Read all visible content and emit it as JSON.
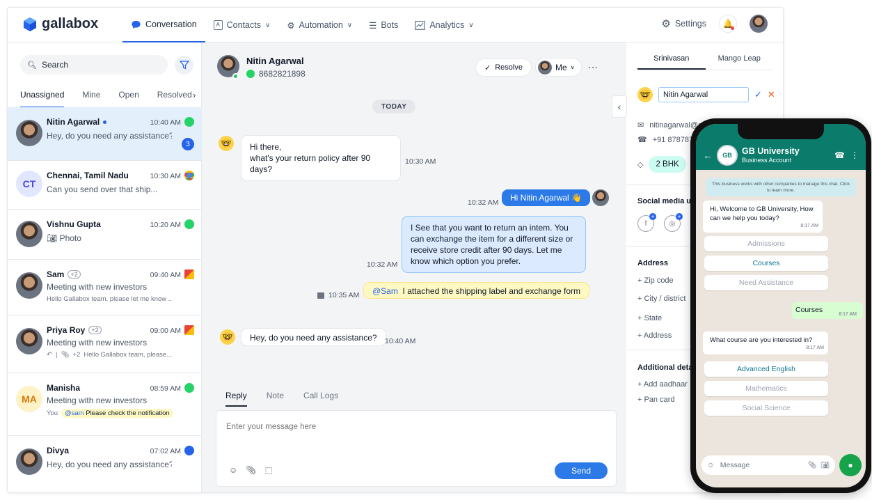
{
  "brand": {
    "name": "gallabox",
    "accent": "#2563eb",
    "whatsapp_green": "#25d366"
  },
  "nav": {
    "items": [
      {
        "label": "Conversation",
        "icon": "chat-bubble-icon",
        "active": true
      },
      {
        "label": "Contacts",
        "icon": "contact-card-icon"
      },
      {
        "label": "Automation",
        "icon": "automation-icon"
      },
      {
        "label": "Bots",
        "icon": "bot-icon"
      },
      {
        "label": "Analytics",
        "icon": "analytics-icon"
      }
    ],
    "settings_label": "Settings"
  },
  "sidebar": {
    "search_label": "Search",
    "tabs": [
      {
        "label": "Unassigned",
        "active": true
      },
      {
        "label": "Mine"
      },
      {
        "label": "Open"
      },
      {
        "label": "Resolved"
      }
    ],
    "conversations": [
      {
        "name": "Nitin Agarwal",
        "time": "10:40 AM",
        "message": "Hey, do you need any assistance?",
        "channel": "whatsapp",
        "unread": "3",
        "selected": true
      },
      {
        "name": "Chennai, Tamil Nadu",
        "initials": "CT",
        "time": "10:30 AM",
        "message": "Can you send over that ship...",
        "channel": "chrome"
      },
      {
        "name": "Vishnu Gupta",
        "time": "10:20 AM",
        "message": "Photo",
        "channel": "whatsapp"
      },
      {
        "name": "Sam",
        "plus": "+2",
        "time": "09:40 AM",
        "message": "Meeting with new investors",
        "sub": "Hello Gallabox team, please let me know ..",
        "channel": "gmail"
      },
      {
        "name": "Priya Roy",
        "plus": "+2",
        "time": "09:00 AM",
        "message": "Meeting with new investors",
        "sub_attach": "+2",
        "sub": "Hello Gallabox team, please...",
        "channel": "gmail"
      },
      {
        "name": "Manisha",
        "initials": "MA",
        "time": "08:59 AM",
        "message": "Meeting with new investors",
        "sub_prefix": "You",
        "sub_mention": "@sam",
        "sub": "Please check the notification",
        "channel": "whatsapp"
      },
      {
        "name": "Divya",
        "time": "07:02 AM",
        "message": "Hey, do you need any assistance?",
        "channel": "messenger"
      }
    ]
  },
  "chat": {
    "contact_name": "Nitin Agarwal",
    "contact_phone": "8682821898",
    "resolve_label": "Resolve",
    "assignee_label": "Me",
    "date_divider": "TODAY",
    "messages": [
      {
        "text1": "Hi there,",
        "text2": "what's your return policy after 90 days?",
        "time": "10:30 AM"
      },
      {
        "text": "Hi Nitin Agarwal 👋",
        "time": "10:32 AM"
      },
      {
        "text": "I See that you want to return an intem. You can exchange the item for a different size or receive store credit after 90 days. Let me know which option you prefer.",
        "time": "10:32 AM"
      },
      {
        "mention": "@Sam",
        "text": "I attached the shipping label and exchange form",
        "time": "10:35 AM"
      },
      {
        "text": "Hey, do you need any assistance?",
        "time": "10:40 AM"
      }
    ],
    "reply_tabs": [
      {
        "label": "Reply",
        "active": true
      },
      {
        "label": "Note"
      },
      {
        "label": "Call Logs"
      }
    ],
    "reply_placeholder": "Enter your message here",
    "send_label": "Send"
  },
  "details": {
    "tabs": [
      {
        "label": "Srinivasan",
        "active": true
      },
      {
        "label": "Mango Leap"
      }
    ],
    "name_value": "Nitin Agarwal",
    "email": "nitinagarwal@gmail.com",
    "phone": "+91 8787877",
    "tag": "2 BHK",
    "social_title": "Social media u",
    "address_title": "Address",
    "address_fields": [
      "+ Zip code",
      "+ City / district",
      "+ State",
      "+ Address"
    ],
    "additional_title": "Additional deta",
    "additional_fields": [
      "+ Add aadhaar",
      "+ Pan card"
    ]
  },
  "phone": {
    "business_name": "GB University",
    "business_sub": "Business Account",
    "notice": "This business works with other companies to manage this chat. Click to learn more.",
    "welcome": "Hi, Welcome to GB University, How can we help you today?",
    "welcome_time": "8:17 AM",
    "options_1": [
      {
        "label": "Admissions"
      },
      {
        "label": "Courses",
        "on": true
      },
      {
        "label": "Need Assistance"
      }
    ],
    "outgoing": "Courses",
    "outgoing_time": "8:17 AM",
    "question": "What course are you interested in?",
    "question_time": "8:17 AM",
    "options_2": [
      {
        "label": "Advanced English",
        "on": true
      },
      {
        "label": "Mathematics"
      },
      {
        "label": "Social Science"
      }
    ],
    "input_placeholder": "Message"
  }
}
